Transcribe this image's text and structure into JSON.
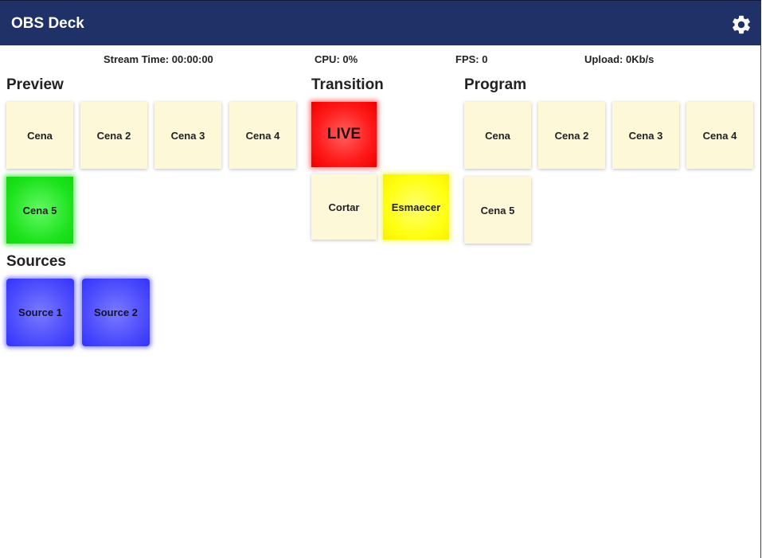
{
  "app": {
    "title": "OBS Deck"
  },
  "header": {
    "settings_icon": "gear-icon"
  },
  "stats": {
    "stream_time": "Stream Time: 00:00:00",
    "cpu": "CPU: 0%",
    "fps": "FPS: 0",
    "upload": "Upload: 0Kb/s"
  },
  "preview": {
    "title": "Preview",
    "scenes": [
      "Cena",
      "Cena 2",
      "Cena 3",
      "Cena 4",
      "Cena 5"
    ],
    "active_scene": "Cena 5"
  },
  "transition": {
    "title": "Transition",
    "live_label": "LIVE",
    "cut_label": "Cortar",
    "fade_label": "Esmaecer"
  },
  "program": {
    "title": "Program",
    "scenes": [
      "Cena",
      "Cena 2",
      "Cena 3",
      "Cena 4",
      "Cena 5"
    ]
  },
  "sources": {
    "title": "Sources",
    "items": [
      "Source 1",
      "Source 2"
    ]
  },
  "colors": {
    "header_bg": "#1f3167",
    "scene_tile": "#fdf8d8",
    "preview_active": "#1be21b",
    "live": "#ff1a1a",
    "fade": "#ffff10",
    "source": "#4a4afc"
  }
}
